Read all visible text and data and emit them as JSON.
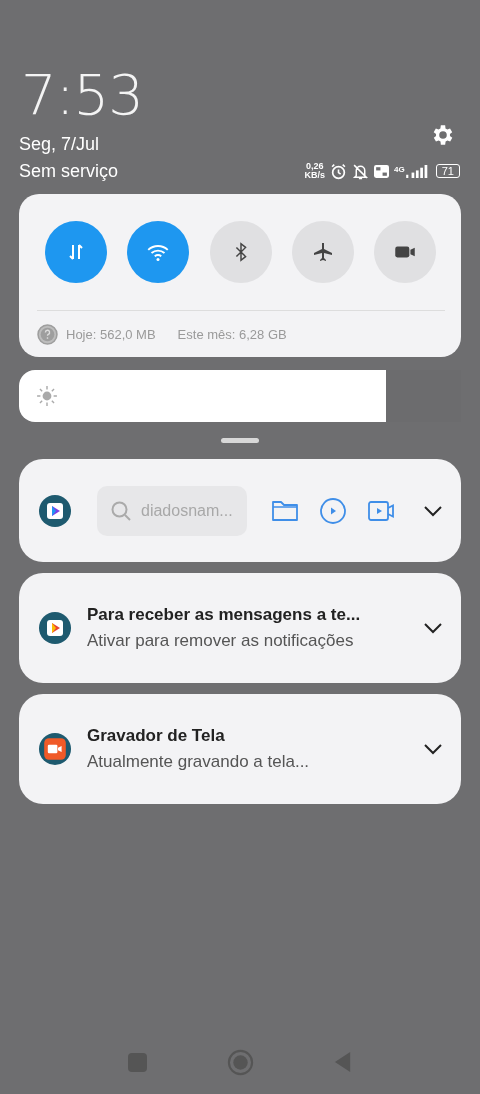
{
  "clock": {
    "time": "7:53",
    "date": "Seg, 7/Jul",
    "carrier": "Sem serviço"
  },
  "status_bar": {
    "speed": "0,26",
    "speed_unit": "KB/s",
    "network": "4G",
    "battery": "71"
  },
  "toggles": [
    {
      "kind": "data",
      "on": true
    },
    {
      "kind": "wifi",
      "on": true
    },
    {
      "kind": "bluetooth",
      "on": false
    },
    {
      "kind": "airplane",
      "on": false
    },
    {
      "kind": "recorder",
      "on": false
    }
  ],
  "data_usage": {
    "today": "Hoje: 562,0 MB",
    "month": "Este mês: 6,28 GB"
  },
  "brightness": {
    "level": 0.83
  },
  "notifications": [
    {
      "kind": "toolbar",
      "icon": {
        "kind": "player"
      },
      "placeholder": "diadosnam..."
    },
    {
      "kind": "message",
      "icon": {
        "kind": "player-color"
      },
      "title": "Para receber as mensagens a te...",
      "text": "Ativar para remover as notificações"
    },
    {
      "kind": "message",
      "icon": {
        "kind": "recorder"
      },
      "title": "Gravador de Tela",
      "text": "Atualmente gravando a tela..."
    }
  ]
}
